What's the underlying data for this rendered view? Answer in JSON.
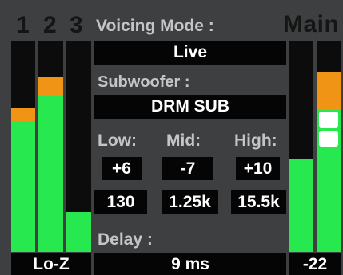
{
  "channels": {
    "numbers": [
      "1",
      "2",
      "3"
    ],
    "levels": [
      {
        "green": 0.62,
        "orange": 0.06
      },
      {
        "green": 0.74,
        "orange": 0.09
      },
      {
        "green": 0.19,
        "orange": 0.0
      }
    ],
    "input_type": "Lo-Z"
  },
  "voicing": {
    "label": "Voicing Mode :",
    "value": "Live"
  },
  "subwoofer": {
    "label": "Subwoofer :",
    "value": "DRM SUB"
  },
  "eq": {
    "headers": [
      "Low:",
      "Mid:",
      "High:"
    ],
    "gains": [
      "+6",
      "-7",
      "+10"
    ],
    "freqs": [
      "130",
      "1.25k",
      "15.5k"
    ]
  },
  "delay": {
    "label": "Delay :",
    "value": "9 ms"
  },
  "main": {
    "label": "Main",
    "level": {
      "green": 0.44,
      "orange": 0.0
    },
    "level2": {
      "green": 0.67,
      "orange": 0.18
    },
    "fader_position": 0.58,
    "value": "-22"
  },
  "colors": {
    "meter_green": "#27e84e",
    "meter_orange": "#f09416",
    "background": "#3d3f40",
    "label_text": "#c3c5c7"
  }
}
